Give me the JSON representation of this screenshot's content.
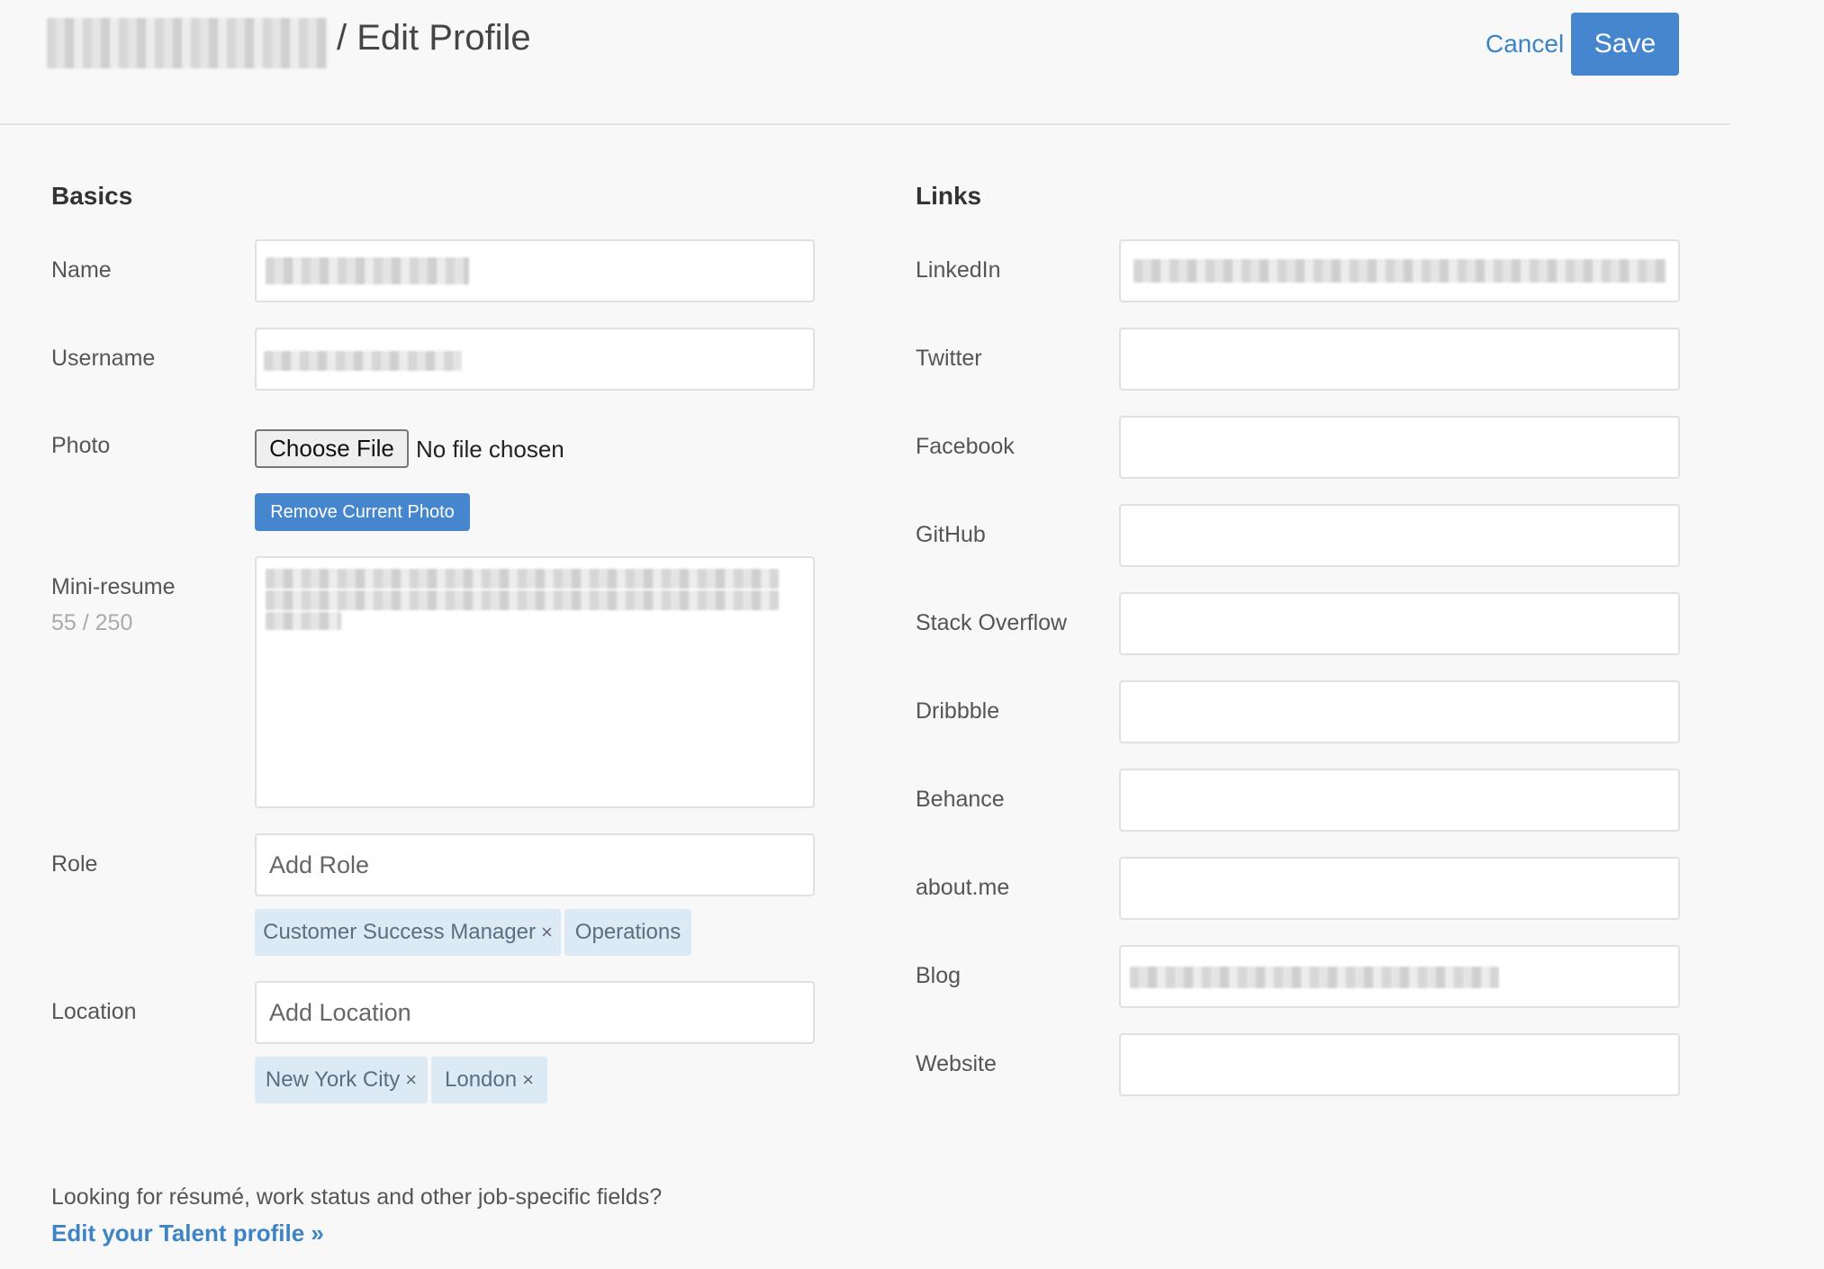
{
  "header": {
    "title_suffix": "/ Edit Profile",
    "cancel_label": "Cancel",
    "save_label": "Save"
  },
  "basics": {
    "title": "Basics",
    "name_label": "Name",
    "username_label": "Username",
    "photo_label": "Photo",
    "choose_file_label": "Choose File",
    "no_file_text": "No file chosen",
    "remove_photo_label": "Remove Current Photo",
    "mini_resume_label": "Mini-resume",
    "mini_resume_counter": "55 / 250",
    "role_label": "Role",
    "role_placeholder": "Add Role",
    "roles": [
      {
        "label": "Customer Success Manager",
        "remove": "×"
      },
      {
        "label": "Operations",
        "remove": ""
      }
    ],
    "location_label": "Location",
    "location_placeholder": "Add Location",
    "locations": [
      {
        "label": "New York City",
        "remove": "×"
      },
      {
        "label": "London",
        "remove": "×"
      }
    ]
  },
  "links": {
    "title": "Links",
    "fields": [
      {
        "label": "LinkedIn"
      },
      {
        "label": "Twitter"
      },
      {
        "label": "Facebook"
      },
      {
        "label": "GitHub"
      },
      {
        "label": "Stack Overflow"
      },
      {
        "label": "Dribbble"
      },
      {
        "label": "Behance"
      },
      {
        "label": "about.me"
      },
      {
        "label": "Blog"
      },
      {
        "label": "Website"
      }
    ]
  },
  "footer": {
    "question": "Looking for résumé, work status and other job-specific fields?",
    "talent_link": "Edit your Talent profile »"
  },
  "colors": {
    "accent": "#4586cf",
    "tag_bg": "#dceaf5",
    "background": "#f8f8f8"
  }
}
